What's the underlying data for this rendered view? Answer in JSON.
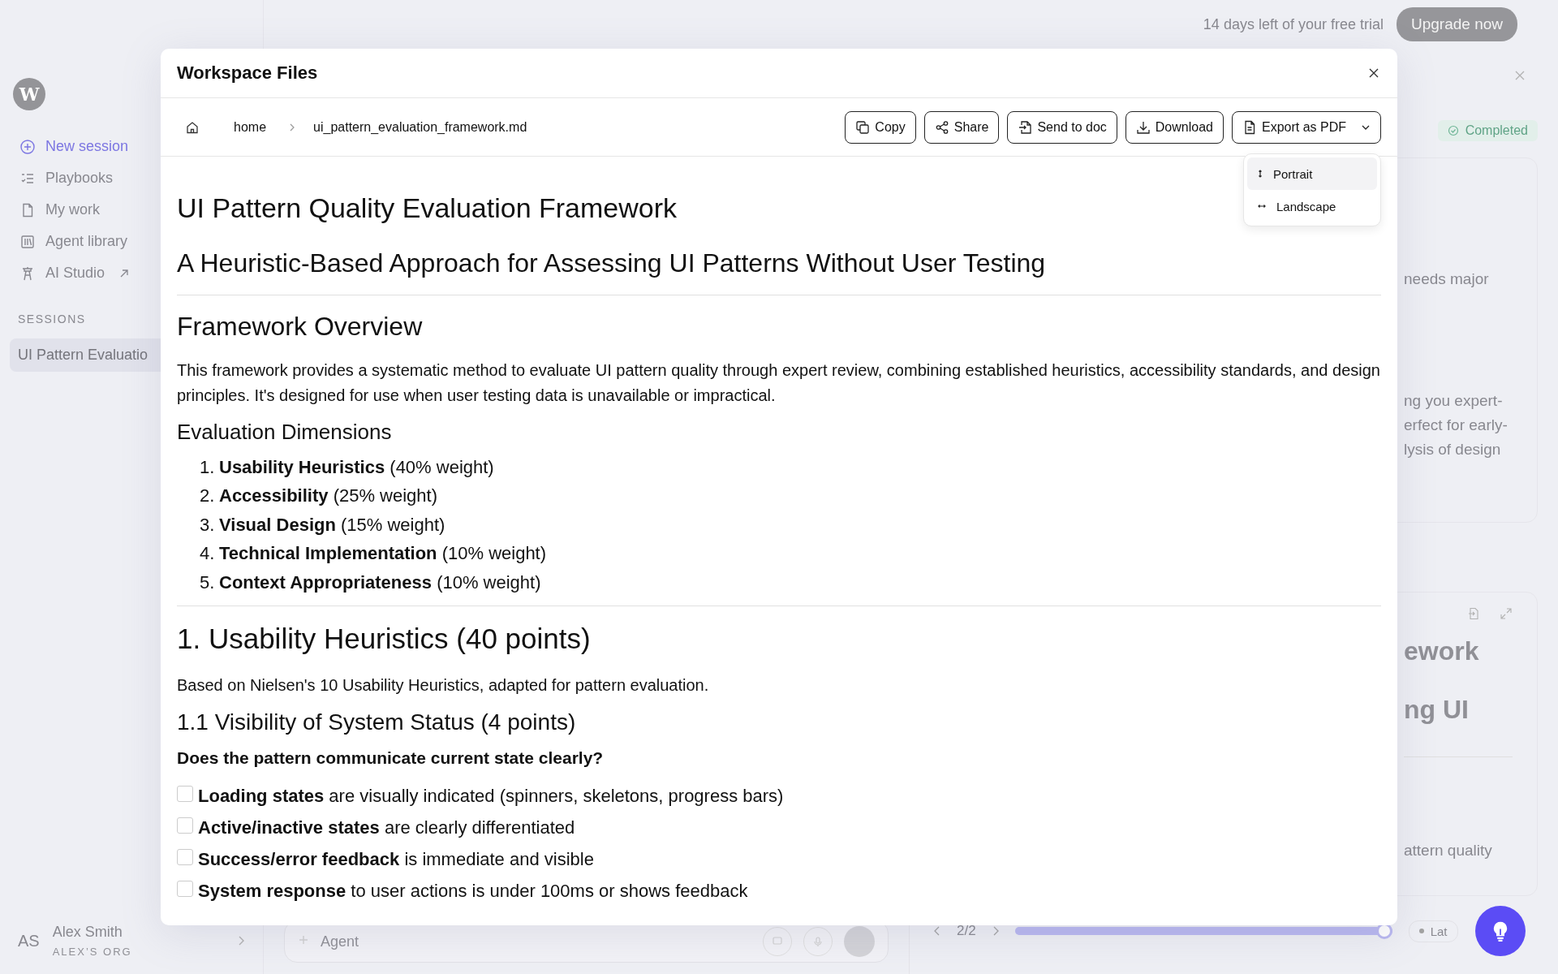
{
  "trial": {
    "text": "14 days left of your free trial",
    "button": "Upgrade now"
  },
  "sidebar": {
    "logo": "W",
    "nav": [
      {
        "label": "New session",
        "selected": true,
        "external": false
      },
      {
        "label": "Playbooks",
        "selected": false,
        "external": false
      },
      {
        "label": "My work",
        "selected": false,
        "external": false
      },
      {
        "label": "Agent library",
        "selected": false,
        "external": false
      },
      {
        "label": "AI Studio",
        "selected": false,
        "external": true
      }
    ],
    "sessions_title": "SESSIONS",
    "sessions": [
      {
        "label": "UI Pattern Evaluatio",
        "selected": true
      }
    ],
    "user": {
      "initials": "AS",
      "name": "Alex Smith",
      "org": "ALEX’S ORG"
    }
  },
  "background": {
    "status": "Completed",
    "card_1_lines": [
      "needs major",
      "ng you expert-",
      "erfect for early-",
      "lysis of design"
    ],
    "card_2_headings": [
      "ework",
      "ng UI"
    ],
    "card_2_line": "attern quality",
    "composer": {
      "mode": "Agent"
    },
    "pager": "2/2",
    "slider": {
      "level": 1
    },
    "tool_pill": "Lat"
  },
  "modal": {
    "title": "Workspace Files",
    "breadcrumb": [
      "home",
      "ui_pattern_evaluation_framework.md"
    ],
    "actions": [
      "Copy",
      "Share",
      "Send to doc",
      "Download",
      "Export as PDF"
    ],
    "export_menu": [
      {
        "label": "Portrait",
        "selected": true
      },
      {
        "label": "Landscape",
        "selected": false
      }
    ],
    "doc": [
      {
        "kind": "h1",
        "text": "UI Pattern Quality Evaluation Framework"
      },
      {
        "kind": "h2",
        "text": "A Heuristic-Based Approach for Assessing UI Patterns Without User Testing"
      },
      {
        "kind": "hr"
      },
      {
        "kind": "h2",
        "text": "Framework Overview"
      },
      {
        "kind": "p",
        "text": "This framework provides a systematic method to evaluate UI pattern quality through expert review, combining established heuristics, accessibility standards, and design principles. It's designed for use when user testing data is unavailable or impractical."
      },
      {
        "kind": "h3",
        "text": "Evaluation Dimensions"
      },
      {
        "kind": "ol",
        "items": [
          {
            "number": "1.",
            "text": "**Usability Heuristics** (40% weight)"
          },
          {
            "number": "2.",
            "text": "**Accessibility** (25% weight)"
          },
          {
            "number": "3.",
            "text": "**Visual Design** (15% weight)"
          },
          {
            "number": "4.",
            "text": "**Technical Implementation** (10% weight)"
          },
          {
            "number": "5.",
            "text": "**Context Appropriateness** (10% weight)"
          }
        ]
      },
      {
        "kind": "hr"
      },
      {
        "kind": "h2big",
        "text": "1. Usability Heuristics (40 points)"
      },
      {
        "kind": "p",
        "text": "Based on Nielsen's 10 Usability Heuristics, adapted for pattern evaluation."
      },
      {
        "kind": "h3big",
        "text": "1.1 Visibility of System Status (4 points)"
      },
      {
        "kind": "q",
        "text": "Does the pattern communicate current state clearly?"
      },
      {
        "kind": "checklist",
        "items": [
          {
            "checked": false,
            "text": "**Loading states** are visually indicated (spinners, skeletons, progress bars)"
          },
          {
            "checked": false,
            "text": "**Active/inactive states** are clearly differentiated"
          },
          {
            "checked": false,
            "text": "**Success/error feedback** is immediate and visible"
          },
          {
            "checked": false,
            "text": "**System response** to user actions is under 100ms or shows feedback"
          }
        ]
      }
    ]
  }
}
